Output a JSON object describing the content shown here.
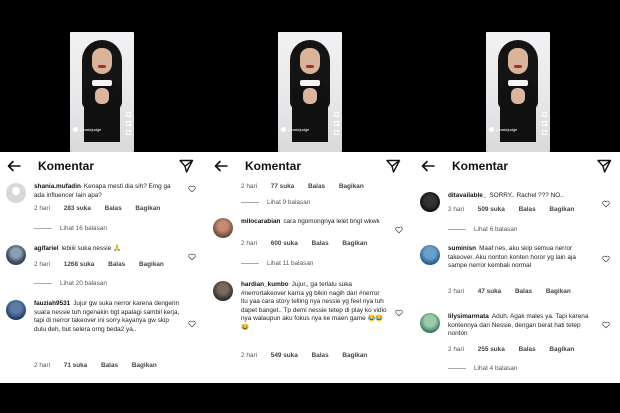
{
  "header": {
    "title": "Komentar"
  },
  "panels": [
    {
      "comments": [
        {
          "username": "shania.mufadin",
          "text": "Kenapa mesti dia sih? Emg ga ada influencer lain apa?",
          "time": "2 hari",
          "likes": "283 suka",
          "reply": "Balas",
          "share": "Bagikan",
          "replies": "Lihat 16 balasan"
        },
        {
          "username": "agifariel",
          "text": "lebiiii suka nessie 🙏",
          "time": "2 hari",
          "likes": "1268 suka",
          "reply": "Balas",
          "share": "Bagikan",
          "replies": "Lihat 20 balasan"
        },
        {
          "username": "fauziah9531",
          "text": "Jujur gw suka nerror karena dengerin suara nessie tuh ngenakin bgt apalagi sambil kerja, tapi di nerror takeover ini sorry kayanya gw skip dulu deh, but selera orng beda2 ya..",
          "time": "2 hari",
          "likes": "71 suka",
          "reply": "Balas",
          "share": "Bagikan"
        }
      ]
    },
    {
      "fragment": {
        "time": "2 hari",
        "likes": "77 suka",
        "reply": "Balas",
        "share": "Bagikan"
      },
      "top_replies": "Lihat 9 balasan",
      "comments": [
        {
          "username": "milocarabian",
          "text": "cara ngomongnya lelet bngt wkwk",
          "time": "2 hari",
          "likes": "600 suka",
          "reply": "Balas",
          "share": "Bagikan",
          "replies": "Lihat 11 balasan"
        },
        {
          "username": "hardian_kumbo",
          "text": "Jujur,, ga terlalu suka #nerrortakeover karna yg bikin nagih dari #nerror itu yaa cara story telling nya nessie yg feel nya tuh dapet banget.. Tp demi nessie tetep di play ko vidio nya walaupun aku fokus nya ke maen game 😂😂😂",
          "time": "2 hari",
          "likes": "549 suka",
          "reply": "Balas",
          "share": "Bagikan"
        }
      ]
    },
    {
      "comments": [
        {
          "username": "ditavailable_",
          "text": "SORRY.. Rachel ??? NO..",
          "time": "2 hari",
          "likes": "509 suka",
          "reply": "Balas",
          "share": "Bagikan",
          "replies": "Lihat 6 balasan"
        },
        {
          "username": "suminisn",
          "text": "Maaf nes, aku skip semua nerror takeover. Aku nonton konten horor yg lain aja sampe nerror kembali normal",
          "time": "2 hari",
          "likes": "47 suka",
          "reply": "Balas",
          "share": "Bagikan"
        },
        {
          "username": "lilysimarmata",
          "text": "Aduh. Agak males ya. Tapi karena kontennya dari Nessie, dengan berat hati tetep nonton",
          "time": "2 hari",
          "likes": "255 suka",
          "reply": "Balas",
          "share": "Bagikan",
          "replies": "Lihat 4 balasan"
        }
      ]
    }
  ],
  "video_overlay": {
    "caption_user": "nessiejudge"
  }
}
